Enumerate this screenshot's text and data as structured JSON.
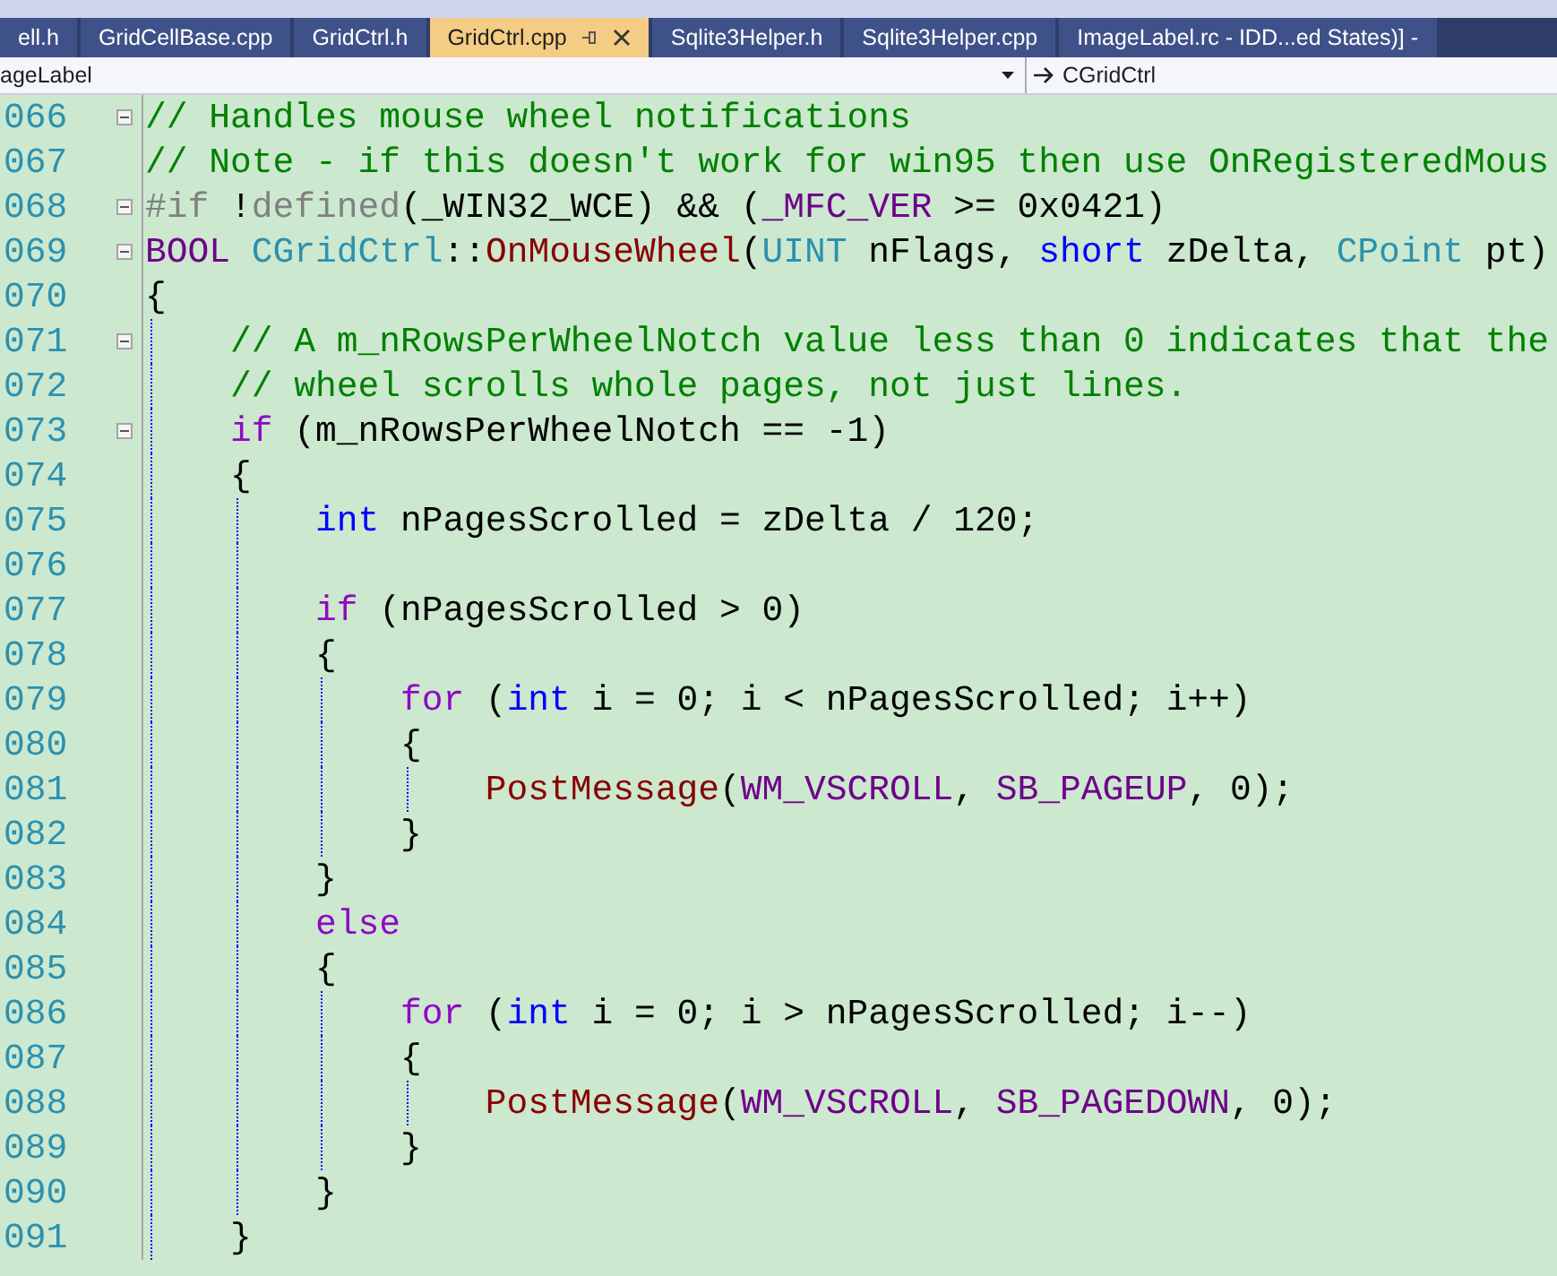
{
  "tabs": [
    {
      "label": "ell.h",
      "selected": false
    },
    {
      "label": "GridCellBase.cpp",
      "selected": false
    },
    {
      "label": "GridCtrl.h",
      "selected": false
    },
    {
      "label": "GridCtrl.cpp",
      "selected": true
    },
    {
      "label": "Sqlite3Helper.h",
      "selected": false
    },
    {
      "label": "Sqlite3Helper.cpp",
      "selected": false
    },
    {
      "label": "ImageLabel.rc - IDD...ed States)] -",
      "selected": false
    }
  ],
  "navigation_bar": {
    "scope": "ageLabel",
    "member": "CGridCtrl"
  },
  "editor": {
    "lines": [
      {
        "number": "066",
        "expanded": true,
        "tokens": [
          {
            "kind": "comment",
            "text": "// Handles mouse wheel notifications"
          }
        ]
      },
      {
        "number": "067",
        "tokens": [
          {
            "kind": "comment",
            "text": "// Note - if this doesn't work for win95 then use OnRegisteredMous"
          }
        ]
      },
      {
        "number": "068",
        "expanded": true,
        "tokens": [
          {
            "kind": "preproc",
            "text": "#if "
          },
          {
            "kind": "plain",
            "text": "!"
          },
          {
            "kind": "preproc",
            "text": "defined"
          },
          {
            "kind": "plain",
            "text": "(_WIN32_WCE) && ("
          },
          {
            "kind": "macro",
            "text": "_MFC_VER"
          },
          {
            "kind": "plain",
            "text": " >= 0x0421)"
          }
        ]
      },
      {
        "number": "069",
        "expanded": true,
        "tokens": [
          {
            "kind": "macro",
            "text": "BOOL "
          },
          {
            "kind": "type",
            "text": "CGridCtrl"
          },
          {
            "kind": "plain",
            "text": "::"
          },
          {
            "kind": "func",
            "text": "OnMouseWheel"
          },
          {
            "kind": "plain",
            "text": "("
          },
          {
            "kind": "type",
            "text": "UINT"
          },
          {
            "kind": "plain",
            "text": " nFlags, "
          },
          {
            "kind": "keyword",
            "text": "short"
          },
          {
            "kind": "plain",
            "text": " zDelta, "
          },
          {
            "kind": "type",
            "text": "CPoint"
          },
          {
            "kind": "plain",
            "text": " pt)"
          }
        ]
      },
      {
        "number": "070",
        "tokens": [
          {
            "kind": "plain",
            "text": "{"
          }
        ]
      },
      {
        "number": "071",
        "expanded": true,
        "tokens": [
          {
            "kind": "comment",
            "text": "    // A m_nRowsPerWheelNotch value less than 0 indicates that the"
          }
        ]
      },
      {
        "number": "072",
        "tokens": [
          {
            "kind": "comment",
            "text": "    // wheel scrolls whole pages, not just lines."
          }
        ]
      },
      {
        "number": "073",
        "expanded": true,
        "tokens": [
          {
            "kind": "control",
            "text": "    if"
          },
          {
            "kind": "plain",
            "text": " (m_nRowsPerWheelNotch == -1)"
          }
        ]
      },
      {
        "number": "074",
        "tokens": [
          {
            "kind": "plain",
            "text": "    {"
          }
        ]
      },
      {
        "number": "075",
        "tokens": [
          {
            "kind": "keyword",
            "text": "        int"
          },
          {
            "kind": "plain",
            "text": " nPagesScrolled = zDelta / 120;"
          }
        ]
      },
      {
        "number": "076"
      },
      {
        "number": "077",
        "tokens": [
          {
            "kind": "control",
            "text": "        if"
          },
          {
            "kind": "plain",
            "text": " (nPagesScrolled > 0)"
          }
        ]
      },
      {
        "number": "078",
        "tokens": [
          {
            "kind": "plain",
            "text": "        {"
          }
        ]
      },
      {
        "number": "079",
        "tokens": [
          {
            "kind": "control",
            "text": "            for"
          },
          {
            "kind": "plain",
            "text": " ("
          },
          {
            "kind": "keyword",
            "text": "int"
          },
          {
            "kind": "plain",
            "text": " i = 0; i < nPagesScrolled; i++)"
          }
        ]
      },
      {
        "number": "080",
        "tokens": [
          {
            "kind": "plain",
            "text": "            {"
          }
        ]
      },
      {
        "number": "081",
        "tokens": [
          {
            "kind": "func",
            "text": "                PostMessage"
          },
          {
            "kind": "plain",
            "text": "("
          },
          {
            "kind": "macro",
            "text": "WM_VSCROLL"
          },
          {
            "kind": "plain",
            "text": ", "
          },
          {
            "kind": "macro",
            "text": "SB_PAGEUP"
          },
          {
            "kind": "plain",
            "text": ", 0);"
          }
        ]
      },
      {
        "number": "082",
        "tokens": [
          {
            "kind": "plain",
            "text": "            }"
          }
        ]
      },
      {
        "number": "083",
        "tokens": [
          {
            "kind": "plain",
            "text": "        }"
          }
        ]
      },
      {
        "number": "084",
        "tokens": [
          {
            "kind": "control",
            "text": "        else"
          }
        ]
      },
      {
        "number": "085",
        "tokens": [
          {
            "kind": "plain",
            "text": "        {"
          }
        ]
      },
      {
        "number": "086",
        "tokens": [
          {
            "kind": "control",
            "text": "            for"
          },
          {
            "kind": "plain",
            "text": " ("
          },
          {
            "kind": "keyword",
            "text": "int"
          },
          {
            "kind": "plain",
            "text": " i = 0; i > nPagesScrolled; i--)"
          }
        ]
      },
      {
        "number": "087",
        "tokens": [
          {
            "kind": "plain",
            "text": "            {"
          }
        ]
      },
      {
        "number": "088",
        "tokens": [
          {
            "kind": "func",
            "text": "                PostMessage"
          },
          {
            "kind": "plain",
            "text": "("
          },
          {
            "kind": "macro",
            "text": "WM_VSCROLL"
          },
          {
            "kind": "plain",
            "text": ", "
          },
          {
            "kind": "macro",
            "text": "SB_PAGEDOWN"
          },
          {
            "kind": "plain",
            "text": ", 0);"
          }
        ]
      },
      {
        "number": "089",
        "tokens": [
          {
            "kind": "plain",
            "text": "            }"
          }
        ]
      },
      {
        "number": "090",
        "tokens": [
          {
            "kind": "plain",
            "text": "        }"
          }
        ]
      },
      {
        "number": "091",
        "tokens": [
          {
            "kind": "plain",
            "text": "    }"
          }
        ]
      }
    ]
  }
}
